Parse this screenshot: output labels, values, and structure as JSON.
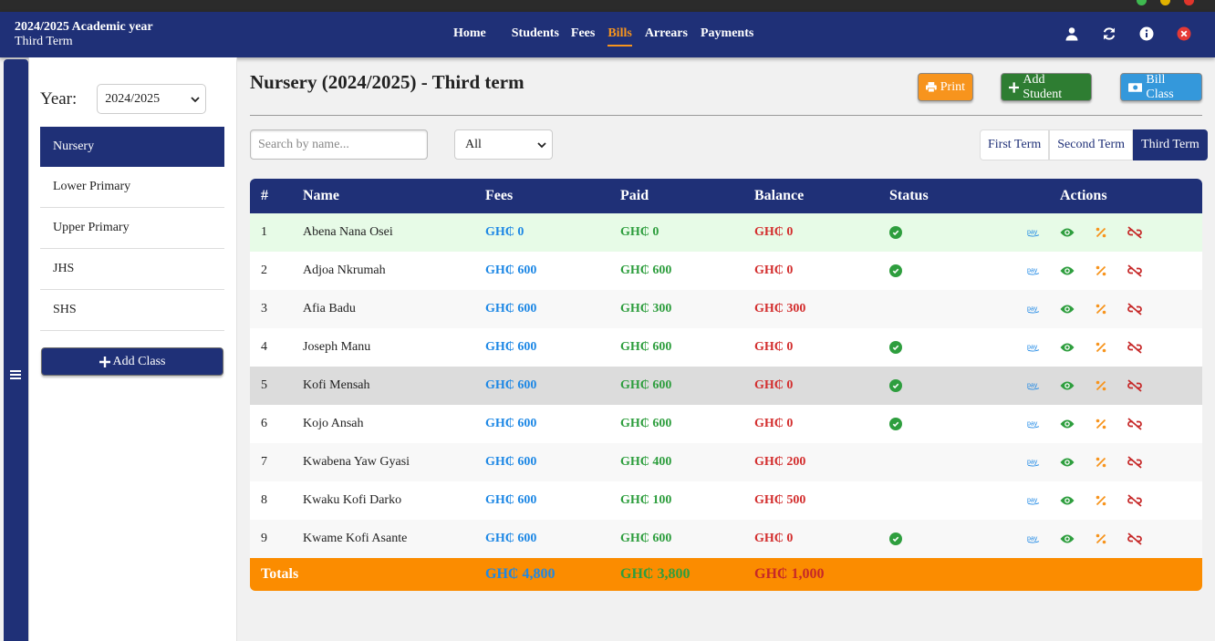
{
  "header": {
    "academic_year": "2024/2025 Academic year",
    "term": "Third Term",
    "nav": [
      "Home",
      "Students",
      "Fees",
      "Bills",
      "Arrears",
      "Payments"
    ],
    "active_nav": "Bills"
  },
  "sidebar": {
    "year_label": "Year:",
    "year_value": "2024/2025",
    "classes": [
      "Nursery",
      "Lower Primary",
      "Upper Primary",
      "JHS",
      "SHS"
    ],
    "active_class": "Nursery",
    "add_class_label": "Add Class"
  },
  "main": {
    "title": "Nursery (2024/2025) - Third term",
    "print_label": "Print",
    "add_student_label": "Add Student",
    "bill_class_label": "Bill Class",
    "search_placeholder": "Search by name...",
    "filter_value": "All",
    "terms": [
      "First Term",
      "Second Term",
      "Third Term"
    ],
    "active_term": "Third Term"
  },
  "table": {
    "headers": [
      "#",
      "Name",
      "Fees",
      "Paid",
      "Balance",
      "Status",
      "Actions"
    ],
    "rows": [
      {
        "num": "1",
        "name": "Abena Nana Osei",
        "fees": "GH₵ 0",
        "paid": "GH₵ 0",
        "balance": "GH₵ 0",
        "status": "paid"
      },
      {
        "num": "2",
        "name": "Adjoa Nkrumah",
        "fees": "GH₵ 600",
        "paid": "GH₵ 600",
        "balance": "GH₵ 0",
        "status": "paid"
      },
      {
        "num": "3",
        "name": "Afia Badu",
        "fees": "GH₵ 600",
        "paid": "GH₵ 300",
        "balance": "GH₵ 300",
        "status": ""
      },
      {
        "num": "4",
        "name": "Joseph Manu",
        "fees": "GH₵ 600",
        "paid": "GH₵ 600",
        "balance": "GH₵ 0",
        "status": "paid"
      },
      {
        "num": "5",
        "name": "Kofi Mensah",
        "fees": "GH₵ 600",
        "paid": "GH₵ 600",
        "balance": "GH₵ 0",
        "status": "paid"
      },
      {
        "num": "6",
        "name": "Kojo Ansah",
        "fees": "GH₵ 600",
        "paid": "GH₵ 600",
        "balance": "GH₵ 0",
        "status": "paid"
      },
      {
        "num": "7",
        "name": "Kwabena Yaw Gyasi",
        "fees": "GH₵ 600",
        "paid": "GH₵ 400",
        "balance": "GH₵ 200",
        "status": ""
      },
      {
        "num": "8",
        "name": "Kwaku Kofi Darko",
        "fees": "GH₵ 600",
        "paid": "GH₵ 100",
        "balance": "GH₵ 500",
        "status": ""
      },
      {
        "num": "9",
        "name": "Kwame Kofi Asante",
        "fees": "GH₵ 600",
        "paid": "GH₵ 600",
        "balance": "GH₵ 0",
        "status": "paid"
      }
    ],
    "totals": {
      "label": "Totals",
      "fees": "GH₵ 4,800",
      "paid": "GH₵ 3,800",
      "balance": "GH₵ 1,000"
    }
  },
  "icons": {
    "user": "user-icon",
    "refresh": "refresh-icon",
    "info": "info-icon",
    "close": "close-circle-icon",
    "pay": "pay-icon",
    "view": "eye-icon",
    "discount": "percent-icon",
    "unlink": "unlink-icon"
  },
  "colors": {
    "primary": "#1f3077",
    "accent": "#f7941d",
    "fees": "#1e88e5",
    "paid": "#2e9e3e",
    "balance": "#d32f2f"
  }
}
